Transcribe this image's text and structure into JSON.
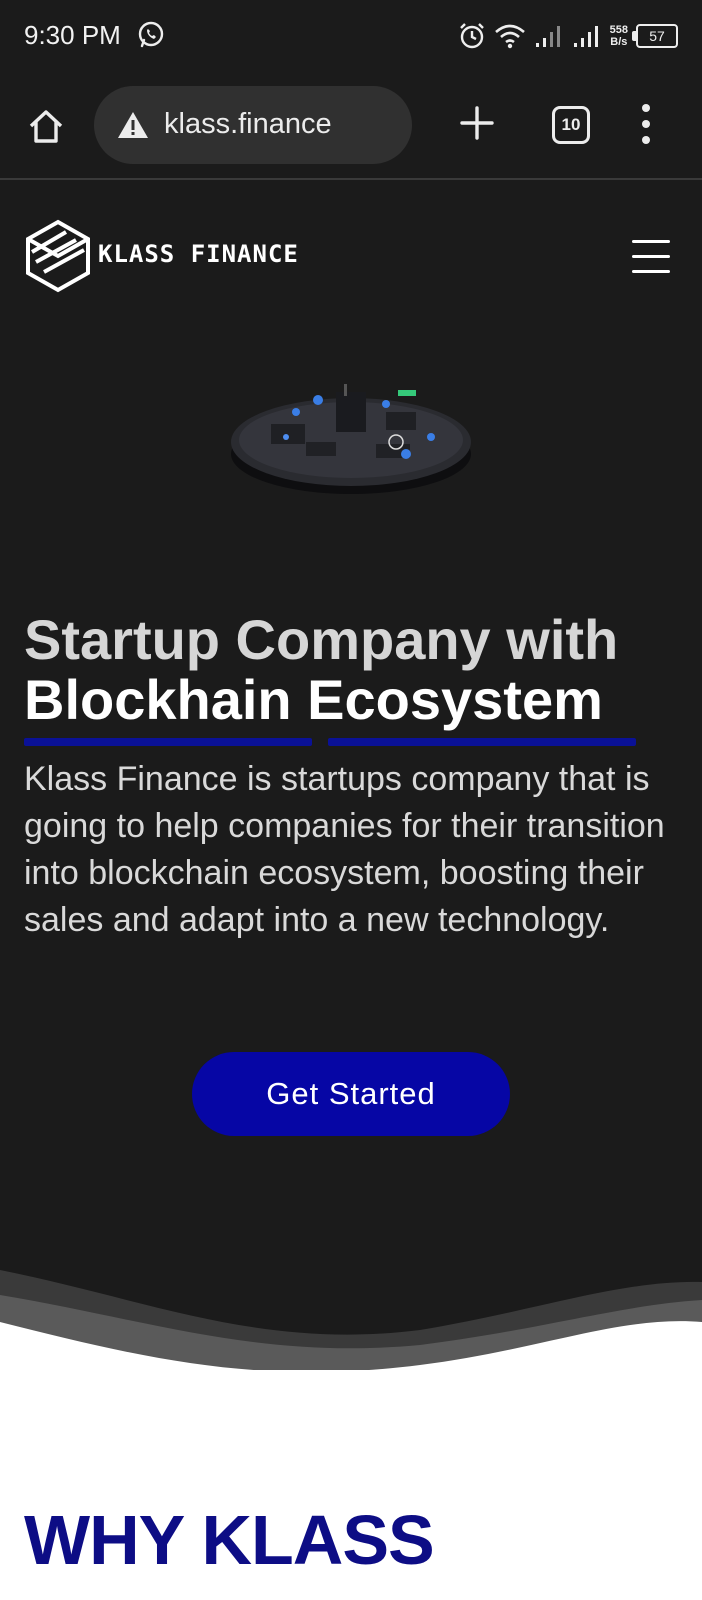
{
  "status_bar": {
    "time": "9:30 PM",
    "net_speed_value": "558",
    "net_speed_unit": "B/s",
    "battery": "57",
    "icons": [
      "whatsapp-icon",
      "alarm-icon",
      "wifi-icon",
      "signal-icon",
      "signal-icon"
    ]
  },
  "browser": {
    "url": "klass.finance",
    "tab_count": "10",
    "icons": [
      "home-icon",
      "warning-icon",
      "plus-icon",
      "tabs-icon",
      "more-vert-icon"
    ]
  },
  "header": {
    "logo_text": "KLASS FINANCE",
    "menu_icon": "hamburger-icon"
  },
  "hero": {
    "title_line1": "Startup Company with",
    "title_line2": "Blockhain Ecosystem",
    "description": "Klass Finance is startups company that is going to help companies for their transition into blockchain ecosystem, boosting their sales and adapt into a new technology.",
    "cta_label": "Get Started",
    "accent_color": "#0606a5",
    "underline_color": "#0a1196"
  },
  "why": {
    "title": "WHY KLASS",
    "title_color": "#0d0d85"
  }
}
